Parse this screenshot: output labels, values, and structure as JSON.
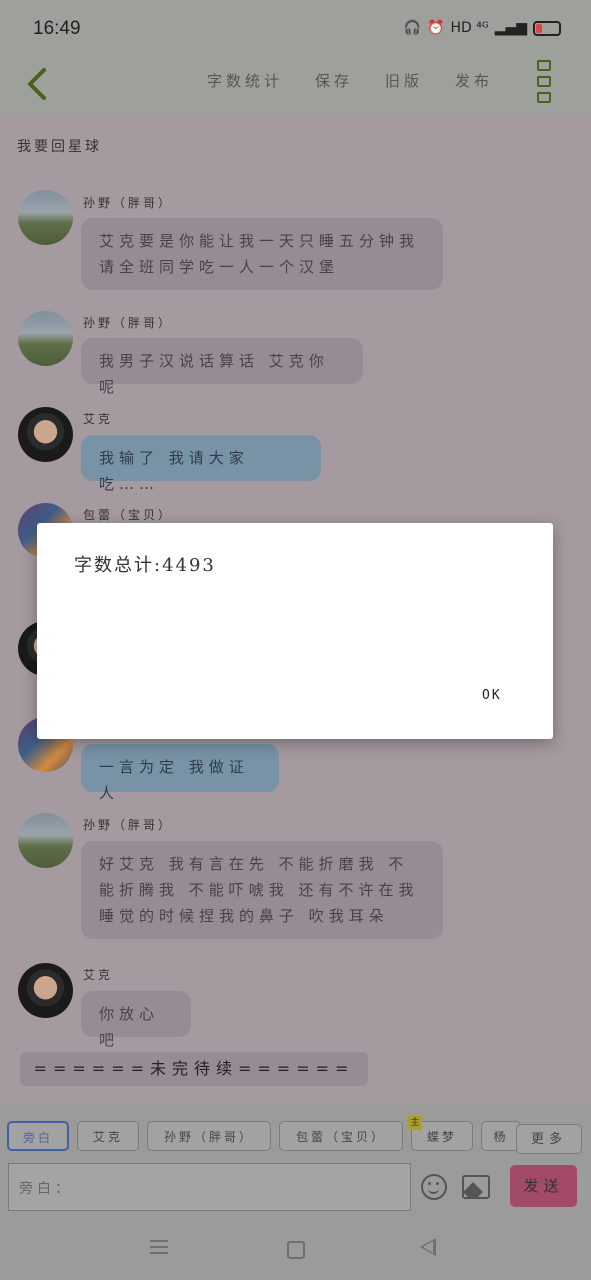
{
  "status_bar": {
    "time": "16:49",
    "icons_text": "HD ⁴ᴳ"
  },
  "toolbar": {
    "menu": [
      "字数统计",
      "保存",
      "旧版",
      "发布"
    ]
  },
  "story": {
    "title": "我要回星球"
  },
  "messages": [
    {
      "name": "孙野（胖哥）",
      "text": "艾克要是你能让我一天只睡五分钟我请全班同学吃一人一个汉堡",
      "avatar": "landscape"
    },
    {
      "name": "孙野（胖哥）",
      "text": "我男子汉说话算话 艾克你呢",
      "avatar": "landscape"
    },
    {
      "name": "艾克",
      "text": "我输了 我请大家吃……",
      "avatar": "boy"
    },
    {
      "name": "包蕾（宝贝）",
      "text": "",
      "avatar": "cartoon"
    },
    {
      "name": "",
      "text": "",
      "avatar": "boy"
    },
    {
      "name": "",
      "text": "一言为定 我做证人",
      "avatar": "cartoon"
    },
    {
      "name": "孙野（胖哥）",
      "text": "好艾克 我有言在先 不能折磨我 不能折腾我 不能吓唬我 还有不许在我睡觉的时候捏我的鼻子 吹我耳朵",
      "avatar": "landscape"
    },
    {
      "name": "艾克",
      "text": "你放心吧",
      "avatar": "boy"
    }
  ],
  "to_be_continued": "======未完待续======",
  "dialog": {
    "title": "字数总计:4493",
    "ok": "OK"
  },
  "characters": [
    {
      "label": "旁白",
      "selected": true
    },
    {
      "label": "艾克",
      "selected": false
    },
    {
      "label": "孙野（胖哥）",
      "selected": false
    },
    {
      "label": "包蕾（宝贝）",
      "selected": false
    },
    {
      "label": "蝶梦",
      "selected": false,
      "badge": "主"
    },
    {
      "label": "杨",
      "selected": false
    }
  ],
  "more_label": "更多",
  "input": {
    "placeholder": "旁白："
  },
  "send_label": "发送"
}
